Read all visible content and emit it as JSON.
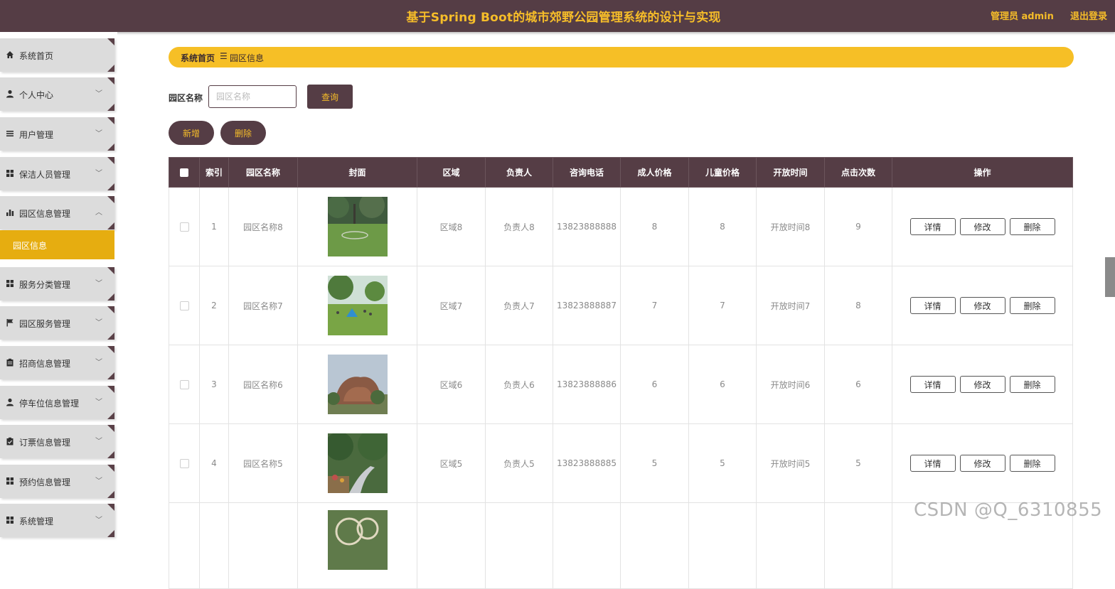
{
  "header": {
    "title": "基于Spring Boot的城市郊野公园管理系统的设计与实现",
    "admin": "管理员 admin",
    "logout": "退出登录"
  },
  "sidebar": {
    "items": [
      {
        "label": "系统首页",
        "icon": "home-icon"
      },
      {
        "label": "个人中心",
        "icon": "user-icon"
      },
      {
        "label": "用户管理",
        "icon": "list-icon"
      },
      {
        "label": "保洁人员管理",
        "icon": "grid-icon"
      },
      {
        "label": "园区信息管理",
        "icon": "bar-chart-icon"
      },
      {
        "label": "服务分类管理",
        "icon": "grid-icon"
      },
      {
        "label": "园区服务管理",
        "icon": "flag-icon"
      },
      {
        "label": "招商信息管理",
        "icon": "clipboard-icon"
      },
      {
        "label": "停车位信息管理",
        "icon": "user-icon"
      },
      {
        "label": "订票信息管理",
        "icon": "clipboard-check-icon"
      },
      {
        "label": "预约信息管理",
        "icon": "grid-icon"
      },
      {
        "label": "系统管理",
        "icon": "grid-icon"
      }
    ],
    "active_sub": "园区信息"
  },
  "breadcrumb": {
    "home": "系统首页",
    "separator": "☰",
    "current": "园区信息"
  },
  "search": {
    "label": "园区名称",
    "placeholder": "园区名称",
    "query_button": "查询"
  },
  "actions": {
    "add": "新增",
    "delete": "删除"
  },
  "table": {
    "columns": [
      "索引",
      "园区名称",
      "封面",
      "区域",
      "负责人",
      "咨询电话",
      "成人价格",
      "儿童价格",
      "开放时间",
      "点击次数",
      "操作"
    ],
    "row_actions": {
      "detail": "详情",
      "edit": "修改",
      "delete": "删除"
    },
    "rows": [
      {
        "index": "1",
        "name": "园区名称8",
        "area": "区域8",
        "manager": "负责人8",
        "phone": "13823888888",
        "adult": "8",
        "child": "8",
        "open": "开放时间8",
        "clicks": "9"
      },
      {
        "index": "2",
        "name": "园区名称7",
        "area": "区域7",
        "manager": "负责人7",
        "phone": "13823888887",
        "adult": "7",
        "child": "7",
        "open": "开放时间7",
        "clicks": "8"
      },
      {
        "index": "3",
        "name": "园区名称6",
        "area": "区域6",
        "manager": "负责人6",
        "phone": "13823888886",
        "adult": "6",
        "child": "6",
        "open": "开放时间6",
        "clicks": "6"
      },
      {
        "index": "4",
        "name": "园区名称5",
        "area": "区域5",
        "manager": "负责人5",
        "phone": "13823888885",
        "adult": "5",
        "child": "5",
        "open": "开放时间5",
        "clicks": "5"
      },
      {
        "index": "",
        "name": "",
        "area": "",
        "manager": "",
        "phone": "",
        "adult": "",
        "child": "",
        "open": "",
        "clicks": ""
      }
    ]
  },
  "watermark": "CSDN @Q_6310855",
  "colors": {
    "header_bg": "#553d45",
    "accent": "#f6bd29",
    "active_menu": "#e6ad10"
  }
}
